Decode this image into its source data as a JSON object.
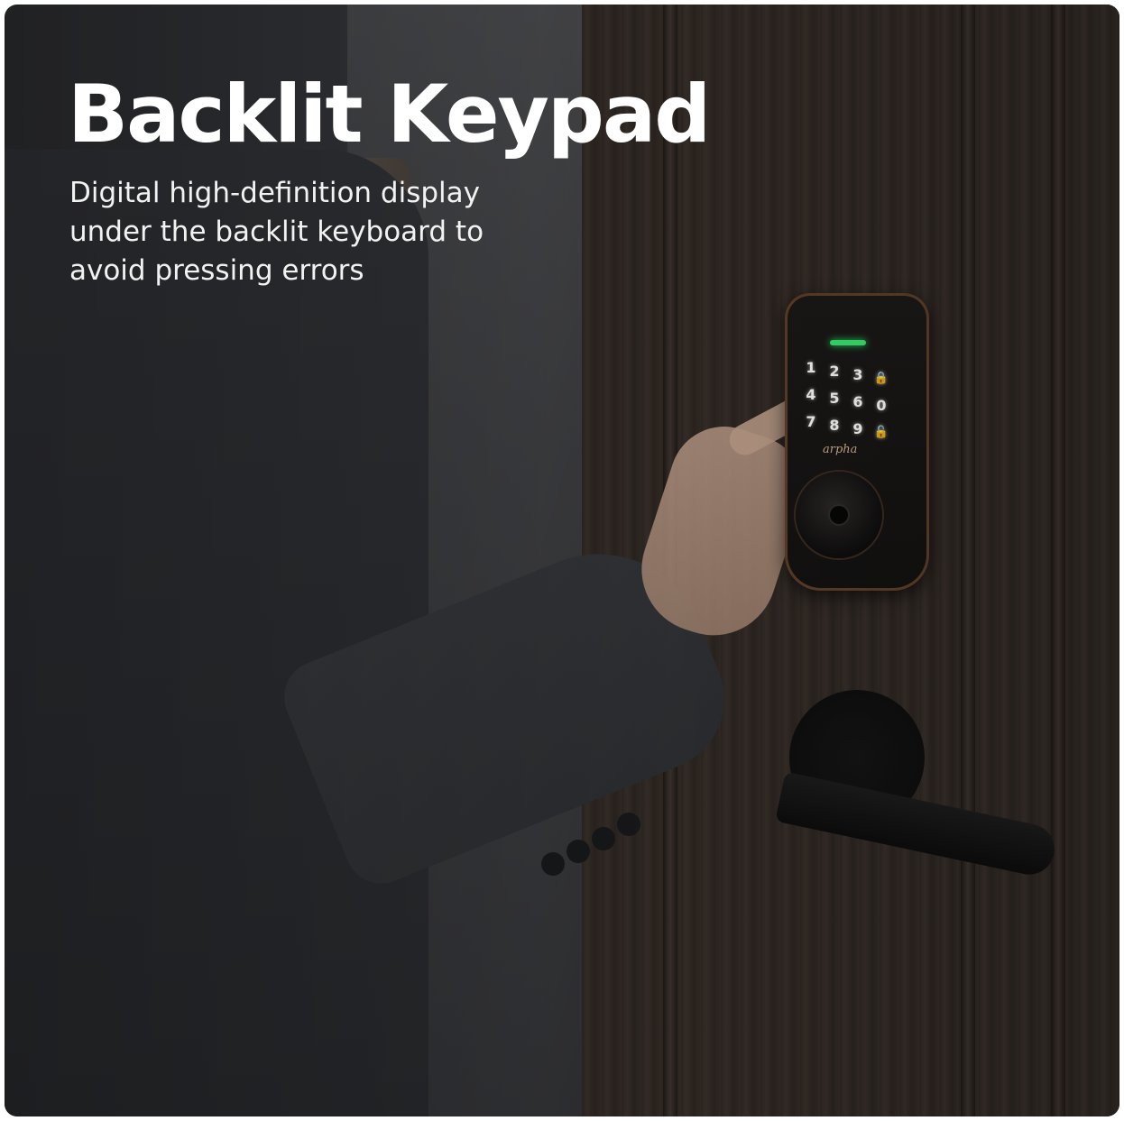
{
  "headline": "Backlit Keypad",
  "subtitle": "Digital high-definition display under the backlit keyboard to avoid pressing errors",
  "lock": {
    "brand": "arpha",
    "keys": [
      "1",
      "2",
      "3",
      "🔒",
      "4",
      "5",
      "6",
      "0",
      "7",
      "8",
      "9",
      "🔓"
    ],
    "led_color": "#35e06a"
  },
  "colors": {
    "door": "#2f2824",
    "jacket": "#2c2e32",
    "lock_trim": "#5b3d27"
  }
}
